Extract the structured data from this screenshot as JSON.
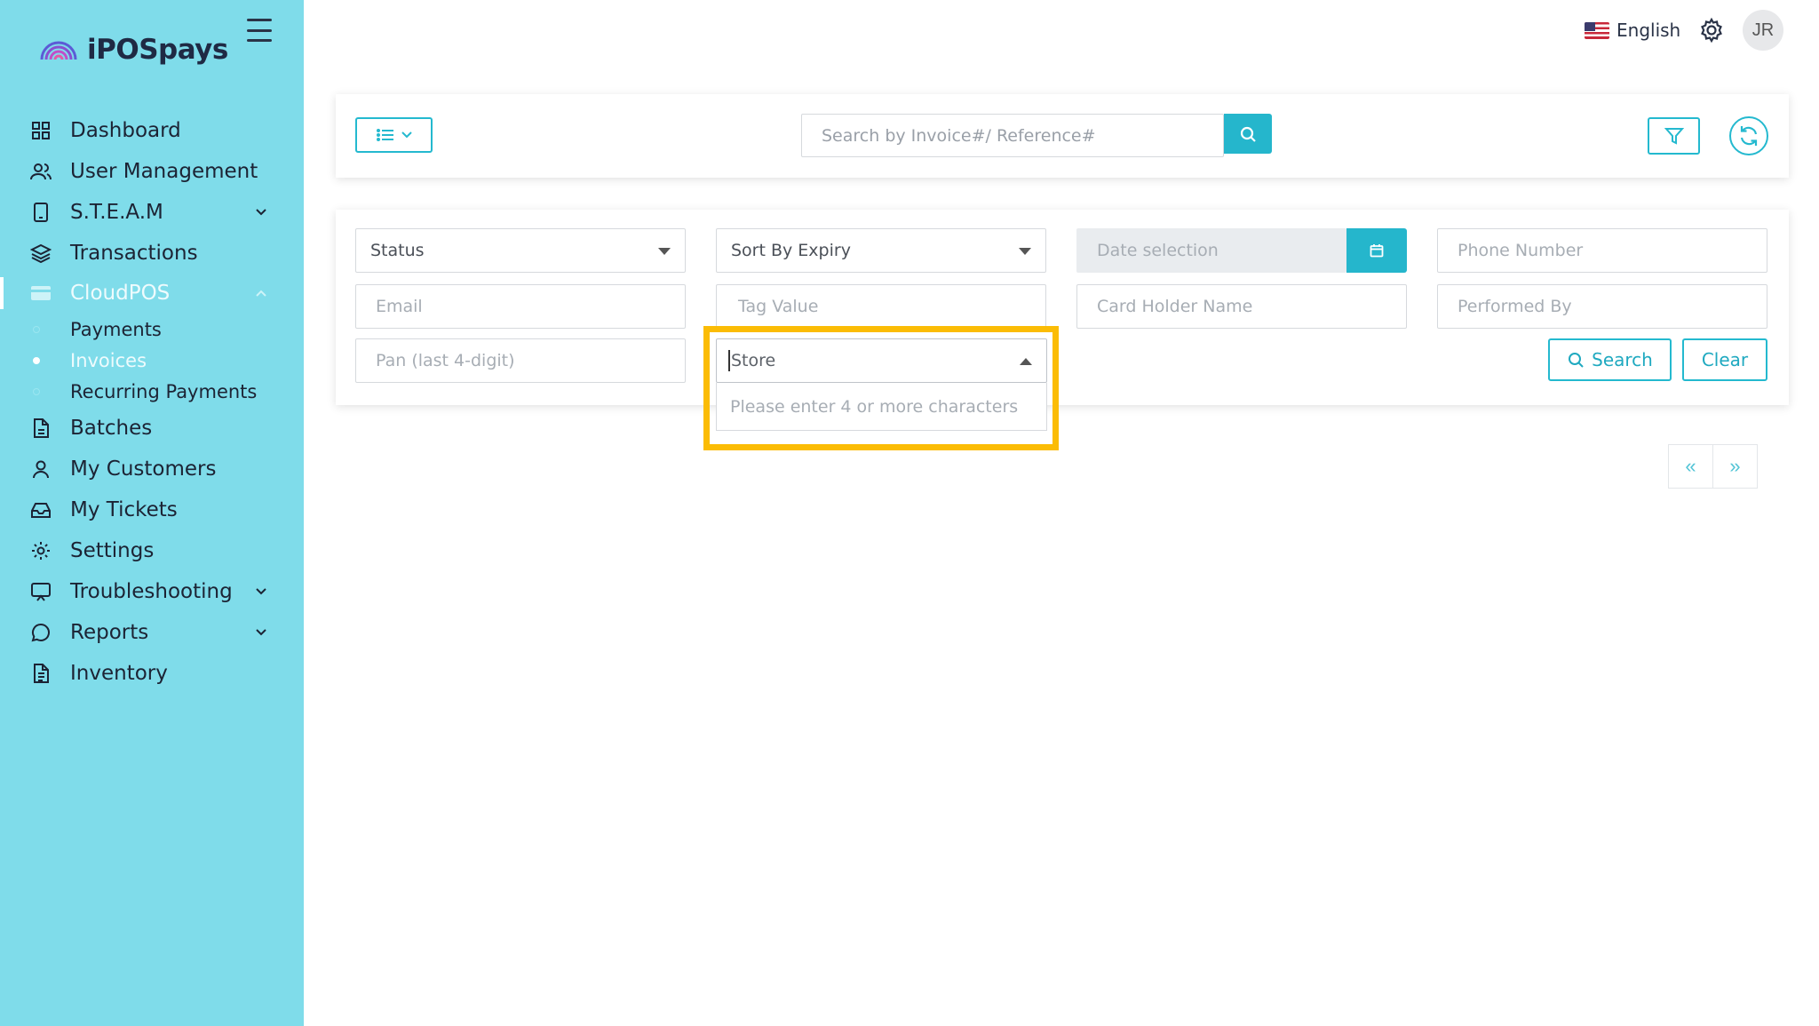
{
  "brand": {
    "name": "iPOSpays"
  },
  "sidebar": {
    "items": [
      {
        "label": "Dashboard",
        "icon": "grid-icon"
      },
      {
        "label": "User Management",
        "icon": "users-icon"
      },
      {
        "label": "S.T.E.A.M",
        "icon": "tablet-icon"
      },
      {
        "label": "Transactions",
        "icon": "layers-icon"
      },
      {
        "label": "CloudPOS",
        "icon": "card-icon"
      },
      {
        "label": "Batches",
        "icon": "file-icon"
      },
      {
        "label": "My Customers",
        "icon": "user-icon"
      },
      {
        "label": "My Tickets",
        "icon": "inbox-icon"
      },
      {
        "label": "Settings",
        "icon": "gear-icon"
      },
      {
        "label": "Troubleshooting",
        "icon": "monitor-icon"
      },
      {
        "label": "Reports",
        "icon": "message-icon"
      },
      {
        "label": "Inventory",
        "icon": "document-icon"
      }
    ],
    "subitems": [
      {
        "label": "Payments"
      },
      {
        "label": "Invoices"
      },
      {
        "label": "Recurring Payments"
      }
    ]
  },
  "topbar": {
    "language": "English",
    "avatar_initials": "JR"
  },
  "search": {
    "placeholder": "Search by Invoice#/ Reference#"
  },
  "filters": {
    "status": "Status",
    "sort": "Sort By Expiry",
    "date_placeholder": "Date selection",
    "phone_placeholder": "Phone Number",
    "email_placeholder": "Email",
    "tag_placeholder": "Tag Value",
    "cardholder_placeholder": "Card Holder Name",
    "performed_placeholder": "Performed By",
    "pan_placeholder": "Pan (last 4-digit)",
    "store": "Store",
    "store_hint": "Please enter 4 or more characters",
    "search_label": "Search",
    "clear_label": "Clear"
  },
  "pagination": {
    "prev": "«",
    "next": "»"
  },
  "colors": {
    "sidebar": "#7fdcea",
    "accent": "#25b6cc",
    "highlight": "#fbbc05"
  }
}
